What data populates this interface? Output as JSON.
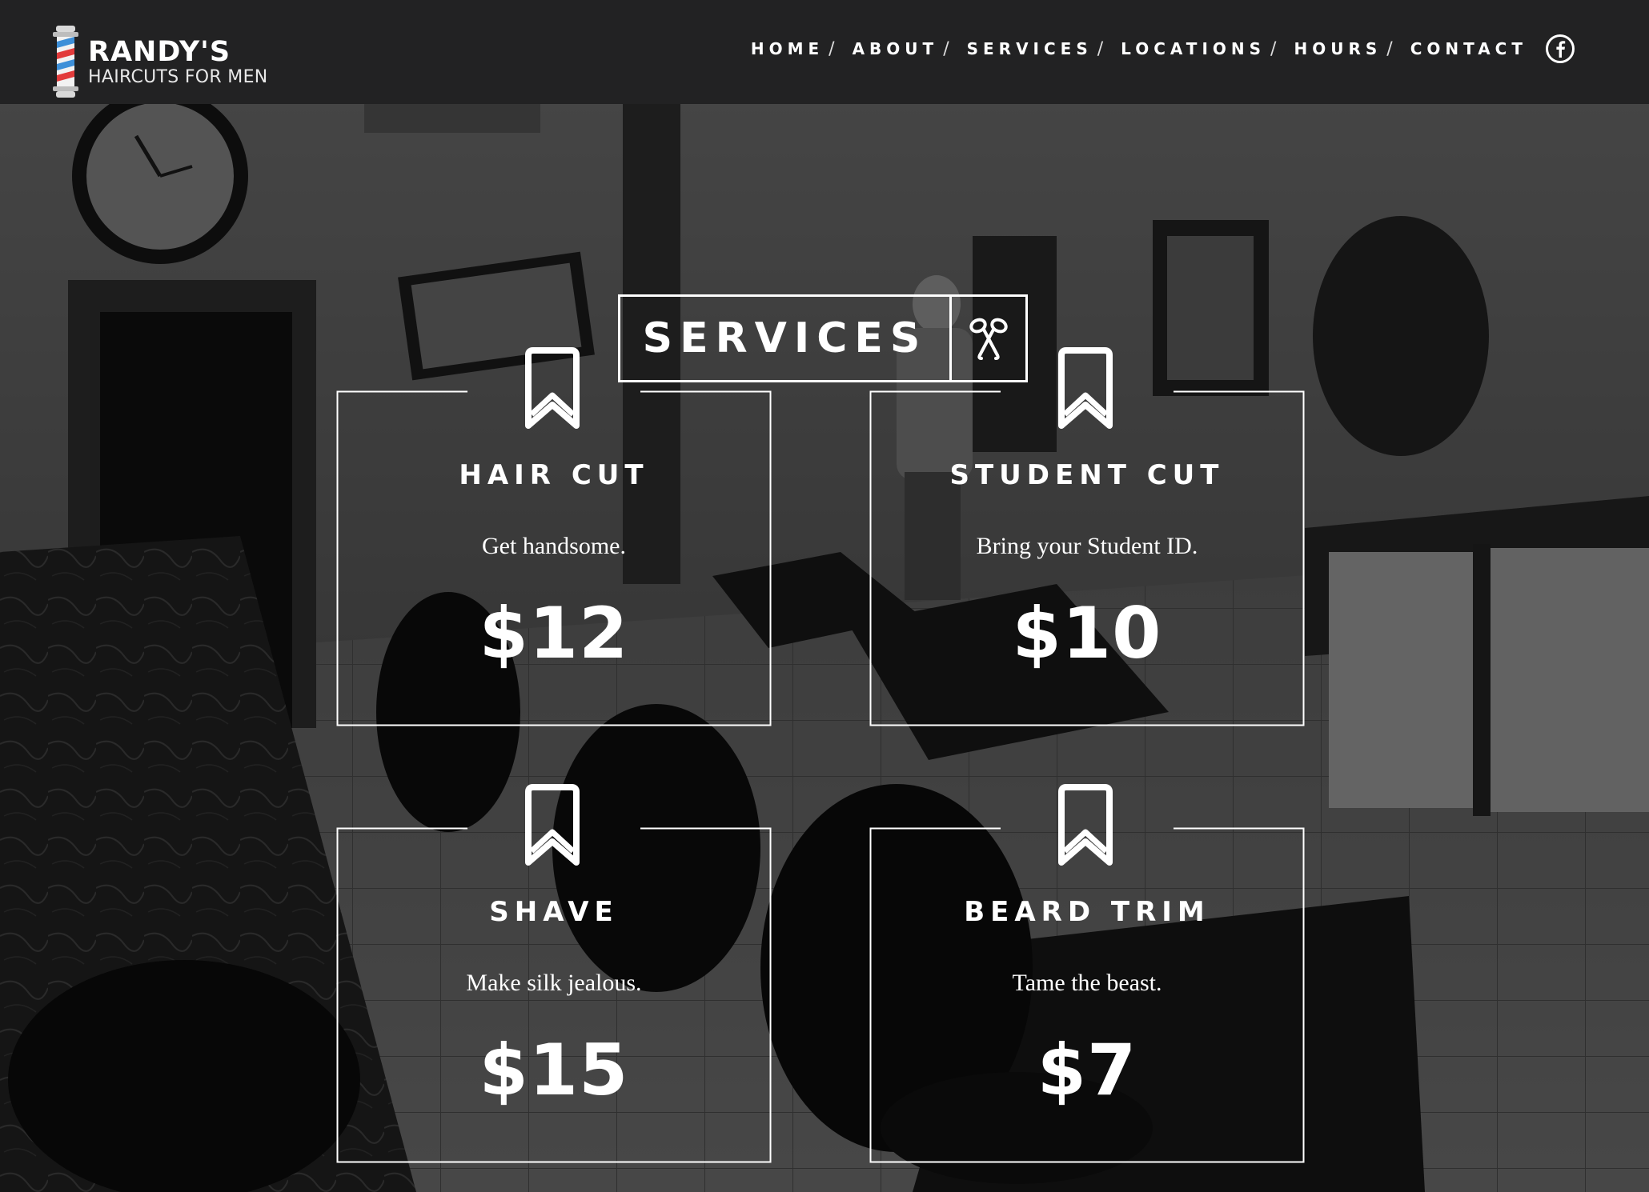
{
  "brand": {
    "name": "RANDY'S",
    "tagline": "HAIRCUTS FOR MEN",
    "colors": {
      "red": "#e23b3b",
      "blue": "#3d8fd8",
      "header_bg": "#222223"
    }
  },
  "nav": {
    "items": [
      {
        "label": "HOME"
      },
      {
        "label": "ABOUT"
      },
      {
        "label": "SERVICES"
      },
      {
        "label": "LOCATIONS"
      },
      {
        "label": "HOURS"
      },
      {
        "label": "CONTACT"
      }
    ],
    "separator": "/",
    "social_icon": "facebook-icon"
  },
  "services": {
    "title": "SERVICES",
    "title_icon": "scissors-icon",
    "cards": [
      {
        "name": "HAIR CUT",
        "description": "Get handsome.",
        "price": "$12",
        "icon": "bookmark-ribbon-icon"
      },
      {
        "name": "STUDENT CUT",
        "description": "Bring your Student ID.",
        "price": "$10",
        "icon": "bookmark-ribbon-icon"
      },
      {
        "name": "SHAVE",
        "description": "Make silk jealous.",
        "price": "$15",
        "icon": "bookmark-ribbon-icon"
      },
      {
        "name": "BEARD TRIM",
        "description": "Tame the beast.",
        "price": "$7",
        "icon": "bookmark-ribbon-icon"
      }
    ]
  }
}
